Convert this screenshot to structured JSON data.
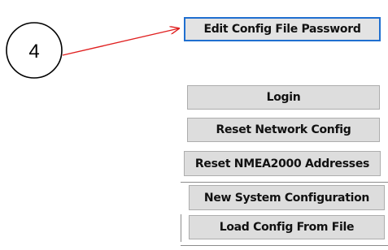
{
  "callout": {
    "number": "4",
    "arrow_color": "#e02020"
  },
  "buttons": {
    "edit_config_password": "Edit Config File Password",
    "login": "Login",
    "reset_network_config": "Reset Network Config",
    "reset_nmea2000": "Reset NMEA2000 Addresses",
    "new_system_config": "New System Configuration",
    "load_config_file": "Load Config From File"
  },
  "colors": {
    "button_face": "#dddddd",
    "button_border": "#adadad",
    "focus_border": "#1f6fd0",
    "callout_arrow": "#e02020"
  }
}
